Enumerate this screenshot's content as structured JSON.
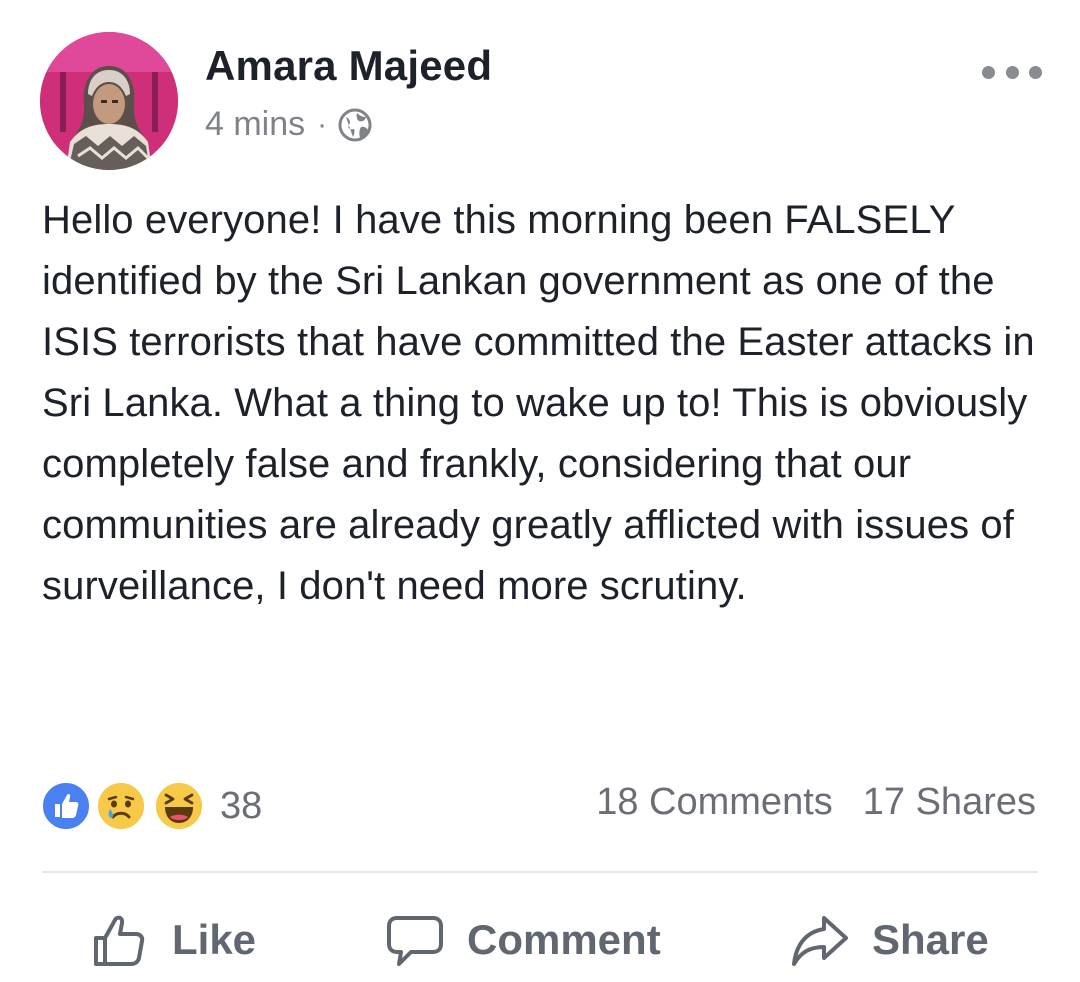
{
  "post": {
    "author": "Amara Majeed",
    "time": "4 mins",
    "separator": "·",
    "privacy_icon": "globe-icon",
    "more_icon": "more-options-icon",
    "text": "Hello everyone! I have this morning been FALSELY identified by the Sri Lankan government as one of the ISIS terrorists that have committed the Easter attacks in Sri Lanka. What a thing to wake up to! This is obviously completely false and frankly, considering that our communities are already greatly afflicted with issues of surveillance, I don't need more scrutiny."
  },
  "reactions": {
    "icons": [
      "like-reaction-icon",
      "sad-reaction-icon",
      "haha-reaction-icon"
    ],
    "count": "38",
    "comments": "18 Comments",
    "shares": "17 Shares"
  },
  "actions": {
    "like": "Like",
    "comment": "Comment",
    "share": "Share"
  },
  "colors": {
    "like_blue": "#4a80f0",
    "emoji_yellow": "#f7c948",
    "muted_text": "#6b6f75",
    "action_text": "#606770"
  }
}
